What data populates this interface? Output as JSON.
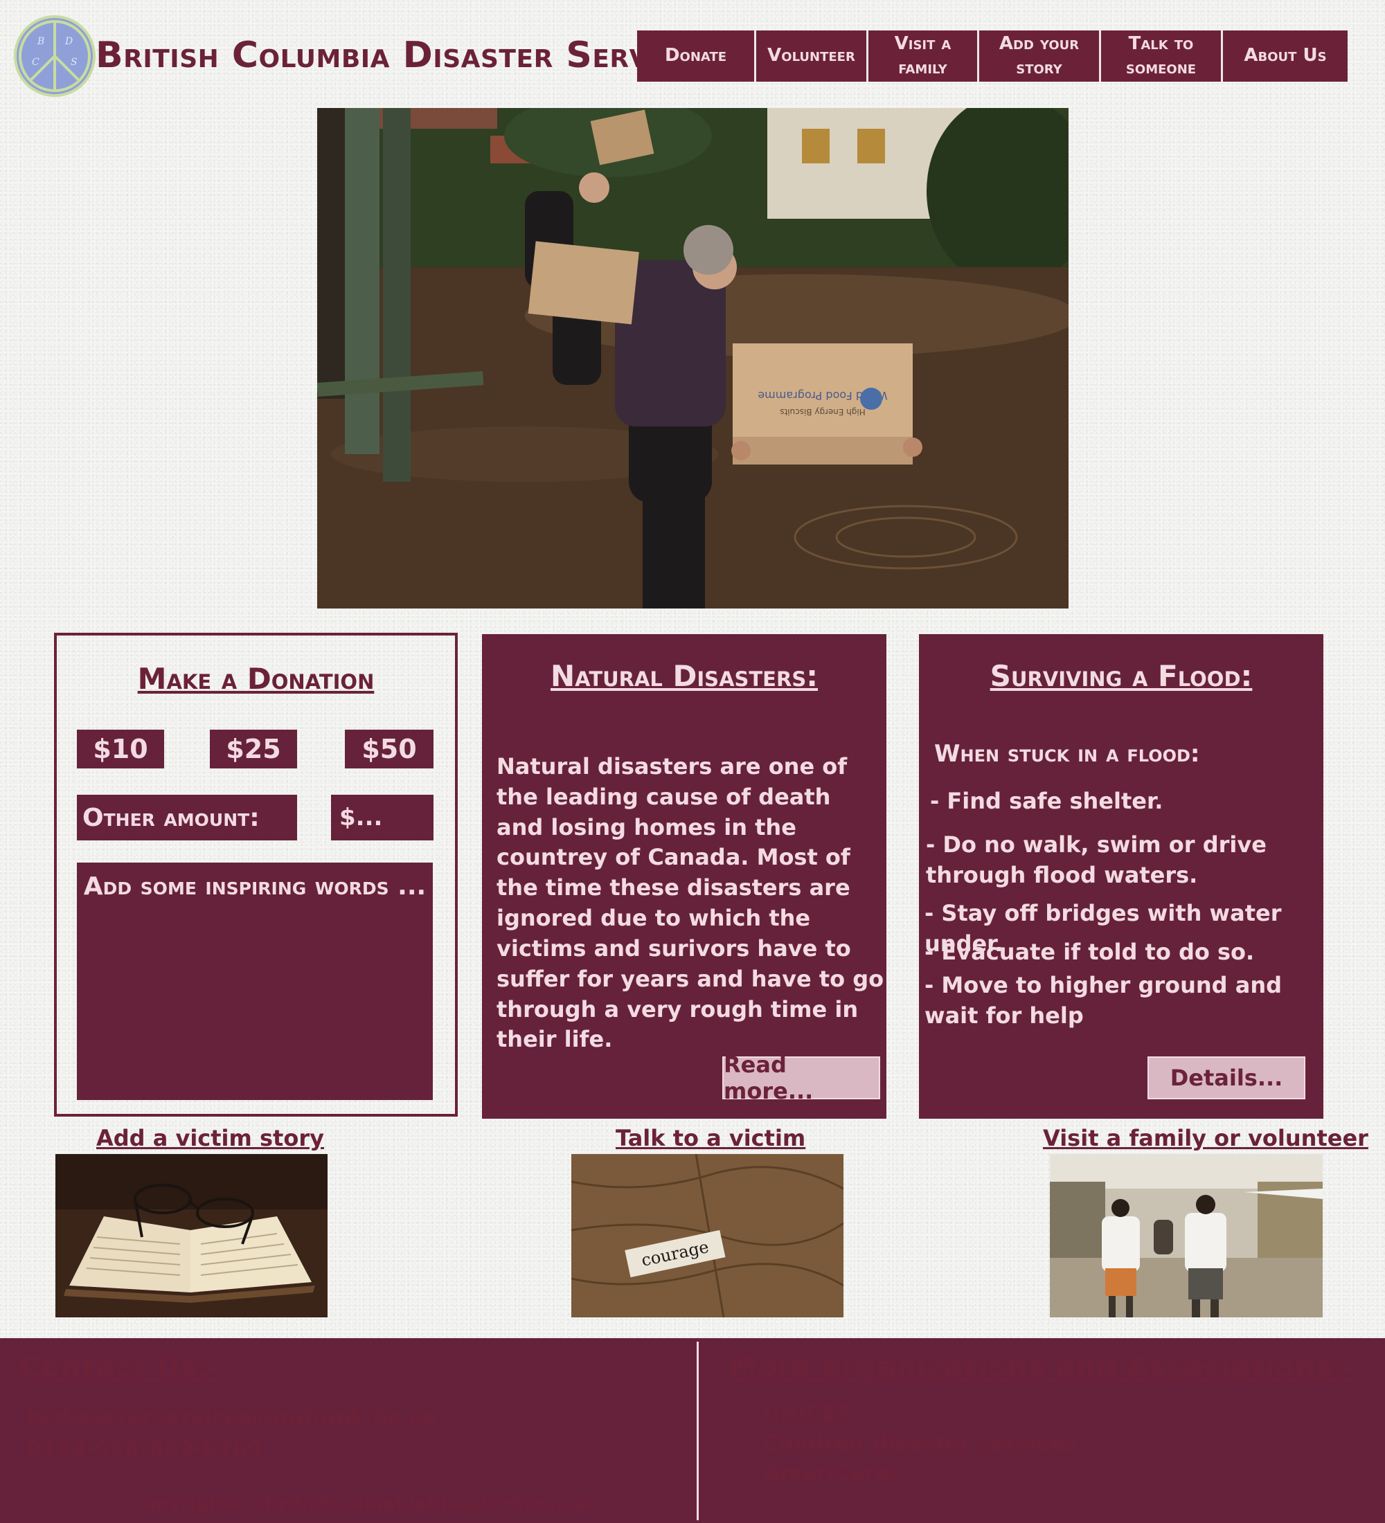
{
  "header": {
    "logo_letters": [
      "B",
      "D",
      "C",
      "S"
    ],
    "brand": "British Columbia Disaster Services",
    "nav": [
      {
        "label": "Donate"
      },
      {
        "label": "Volunteer"
      },
      {
        "label": "Visit a family"
      },
      {
        "label": "Add your story"
      },
      {
        "label": "Talk to someone"
      },
      {
        "label": "About Us"
      }
    ]
  },
  "hero": {
    "box_text": [
      "World Food Programme",
      "High Energy Biscuits"
    ]
  },
  "donation": {
    "title": "Make a Donation",
    "amounts": [
      "$10",
      "$25",
      "$50"
    ],
    "other_label": "Other amount:",
    "other_placeholder": "$...",
    "words_placeholder": "Add some inspiring words ..."
  },
  "natural": {
    "title": "Natural Disasters:",
    "text": "Natural disasters are one of the leading cause of death and losing homes in the countrey of Canada. Most of the time these disasters are ignored due to which the victims and surivors have to suffer for years and have to go through a very rough time in their life.",
    "button": "Read more..."
  },
  "flood": {
    "title": "Surviving a Flood:",
    "subtitle": "When stuck in a flood:",
    "tips": [
      "- Find safe shelter.",
      "- Do no walk, swim or drive through flood waters.",
      "- Stay off bridges with water under.",
      "- Evacuate if told to do so.",
      "- Move to higher ground and wait for help"
    ],
    "button": "Details..."
  },
  "links": {
    "victim_story": "Add a victim story",
    "talk_victim": "Talk to a victim",
    "visit_family": "Visit a family or volunteer",
    "courage_word": "courage"
  },
  "footer": {
    "contact_title": "Contact Us:-",
    "email": "bcdisasterservices@outlook.bc.ca",
    "phone": "0124-998-009-6789",
    "copyright": "Copyrights @BritishColumbiaDisasterServices",
    "orgs_title": "More organizations and Associations:-",
    "orgs": [
      "- UNICEF",
      "- Children disaster services",
      "- AmeriCares"
    ]
  },
  "colors": {
    "maroon": "#66223a",
    "light_pink": "#d9b8c4",
    "text_light": "#f3dbe2",
    "logo_blue": "#8fa0d8"
  }
}
